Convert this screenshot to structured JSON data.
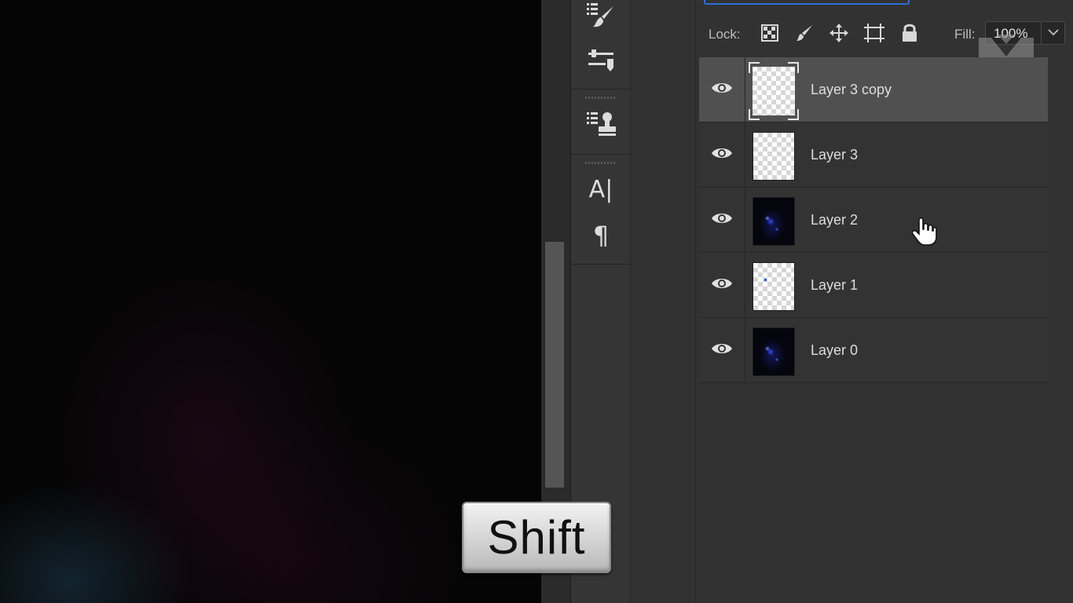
{
  "lock_bar": {
    "lock_label": "Lock:",
    "fill_label": "Fill:",
    "fill_value": "100%",
    "icons": [
      "lock-transparent-pixels-icon",
      "lock-image-pixels-icon",
      "lock-position-icon",
      "lock-artboard-icon",
      "lock-all-icon"
    ]
  },
  "tools": [
    "brush-presets-icon",
    "adjustment-sliders-icon",
    "clone-source-icon",
    "character-icon",
    "paragraph-icon"
  ],
  "layers": [
    {
      "name": "Layer 3 copy",
      "visible": true,
      "thumbnail": "transparent",
      "selected": true
    },
    {
      "name": "Layer 3",
      "visible": true,
      "thumbnail": "transparent",
      "selected": false
    },
    {
      "name": "Layer 2",
      "visible": true,
      "thumbnail": "photo",
      "selected": false
    },
    {
      "name": "Layer 1",
      "visible": true,
      "thumbnail": "transparent-dot",
      "selected": false
    },
    {
      "name": "Layer 0",
      "visible": true,
      "thumbnail": "photo",
      "selected": false
    }
  ],
  "key_overlay": {
    "label": "Shift"
  },
  "colors": {
    "panel": "#323232",
    "selected_row": "#505050",
    "accent": "#2d6fd6"
  }
}
